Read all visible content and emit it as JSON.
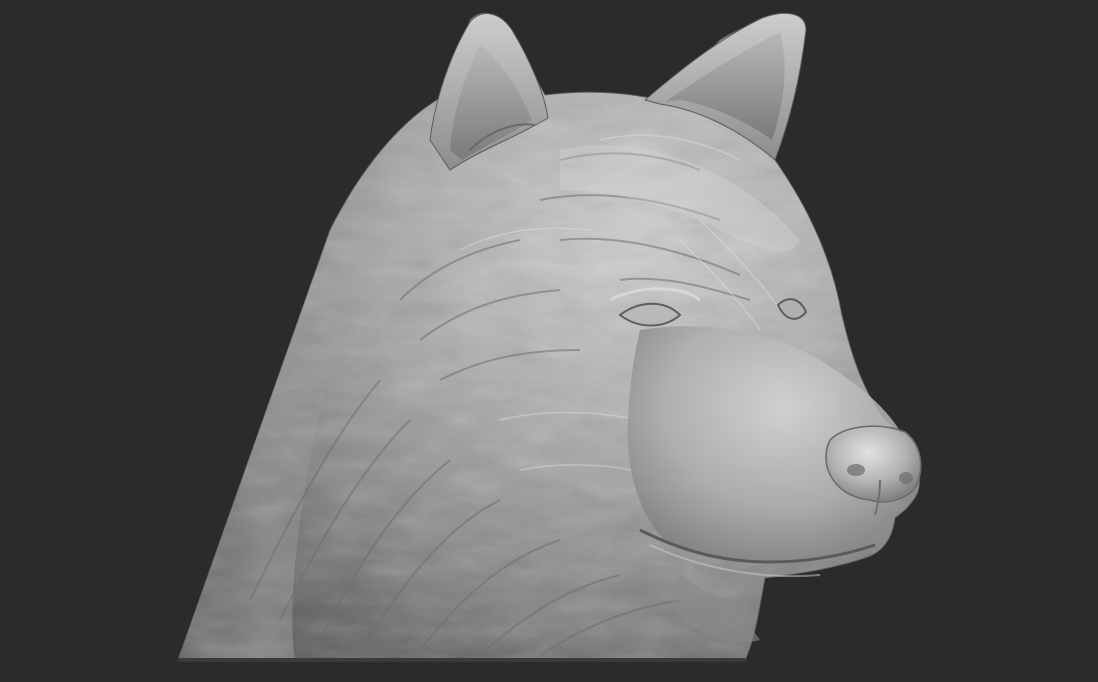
{
  "viewport": {
    "background_color": "#2b2b2b",
    "model": "husky-head-bust",
    "material_color": "#9a9a9a",
    "highlight_color": "#d8d8d8",
    "shadow_color": "#4a4a4a",
    "eyes": "closed"
  }
}
